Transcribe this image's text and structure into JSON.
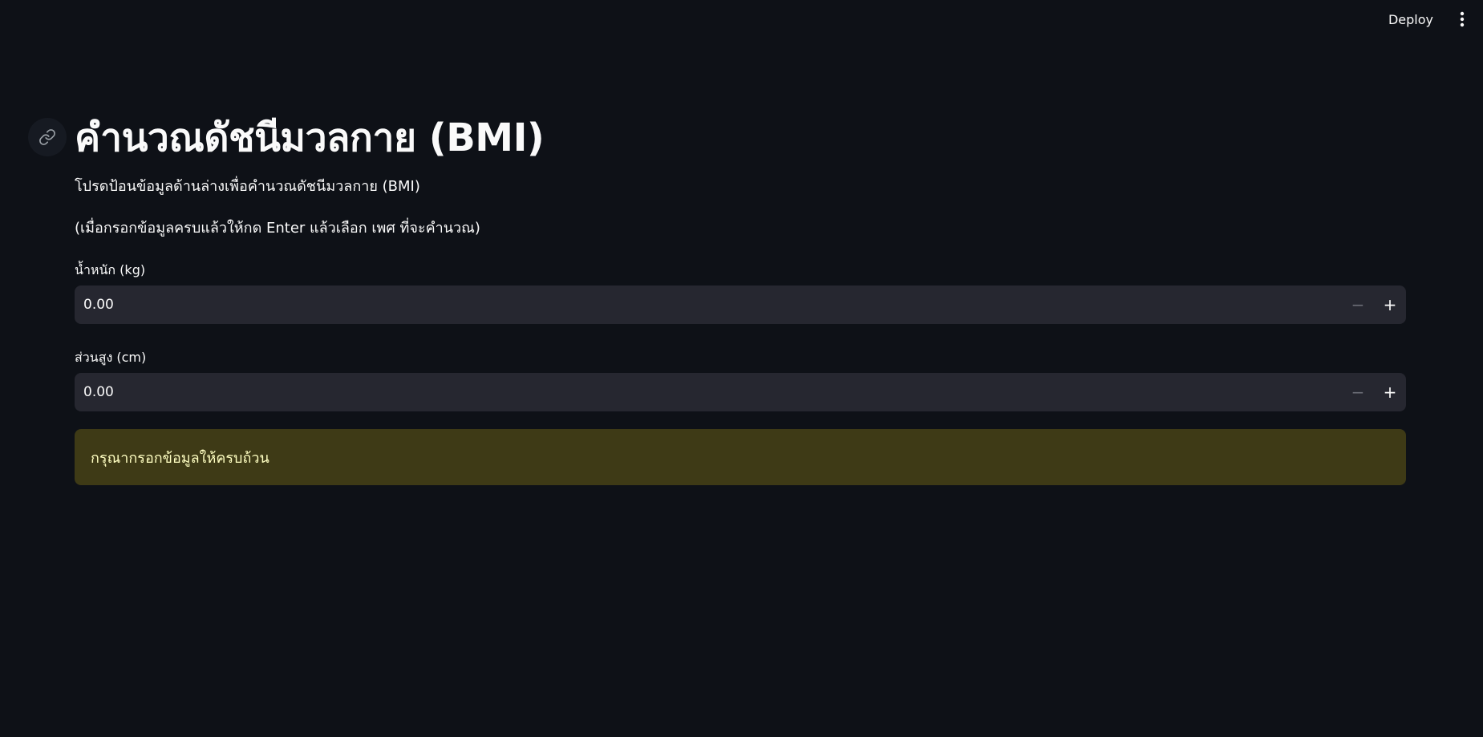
{
  "toolbar": {
    "deploy_label": "Deploy",
    "menu_icon": "kebab-menu-icon"
  },
  "header": {
    "anchor_icon": "link-icon",
    "title": "คำนวณดัชนีมวลกาย (BMI)"
  },
  "content": {
    "intro": "โปรดป้อนข้อมูลด้านล่างเพื่อคำนวณดัชนีมวลกาย (BMI)",
    "instruction": "(เมื่อกรอกข้อมูลครบแล้วให้กด Enter แล้วเลือก เพศ ที่จะคำนวณ)"
  },
  "weight": {
    "label": "น้ำหนัก (kg)",
    "value": "0.00",
    "minus": "−",
    "plus": "+"
  },
  "height": {
    "label": "ส่วนสูง (cm)",
    "value": "0.00",
    "minus": "−",
    "plus": "+"
  },
  "alert": {
    "message": "กรุณากรอกข้อมูลให้ครบถ้วน"
  },
  "colors": {
    "background": "#0e1117",
    "input_bg": "#262730",
    "warning_bg": "#3e3a16",
    "warning_text": "#ffffc2"
  }
}
